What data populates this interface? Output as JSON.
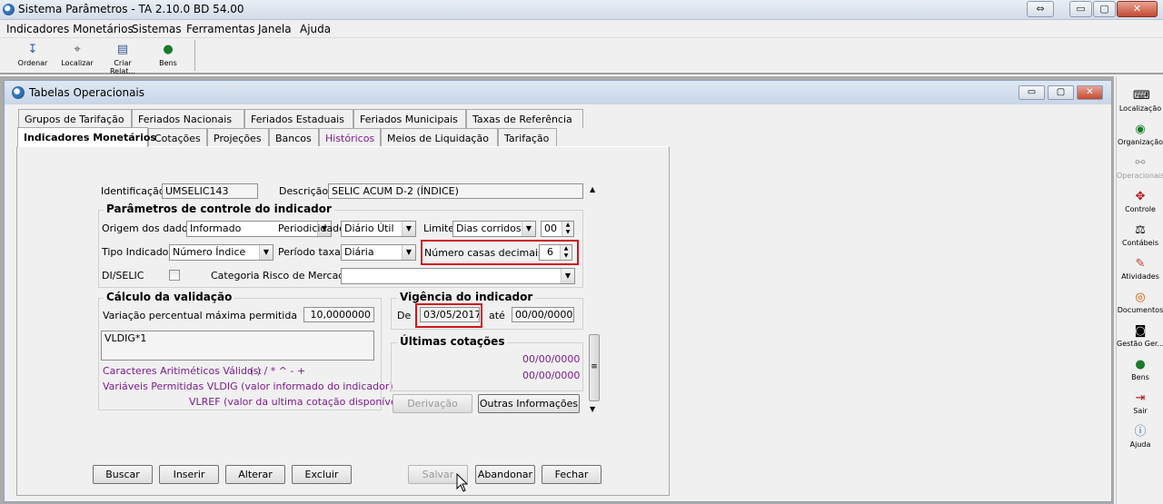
{
  "app": {
    "title": "Sistema Parâmetros -  TA 2.10.0 BD 54.00",
    "title_controls": [
      "⇔",
      "▭",
      "▢",
      "✕"
    ]
  },
  "menu": [
    "Indicadores Monetários",
    "Sistemas",
    "Ferramentas",
    "Janela",
    "Ajuda"
  ],
  "toolbar": [
    {
      "label": "Ordenar",
      "icon": "sort-icon"
    },
    {
      "label": "Localizar",
      "icon": "locate-icon"
    },
    {
      "label": "Criar Relat...",
      "icon": "printer-icon"
    },
    {
      "label": "Bens",
      "icon": "money-bag-icon"
    }
  ],
  "child": {
    "title": "Tabelas Operacionais"
  },
  "tabs_row1": [
    "Grupos de Tarifação",
    "Feriados Nacionais",
    "Feriados Estaduais",
    "Feriados Municipais",
    "Taxas de Referência"
  ],
  "tabs_row2": [
    "Indicadores Monetários",
    "Cotações",
    "Projeções",
    "Bancos",
    "Históricos",
    "Meios de Liquidação",
    "Tarifação"
  ],
  "form": {
    "identificacao_label": "Identificação",
    "identificacao_value": "UMSELIC143",
    "descricao_label": "Descrição",
    "descricao_value": "SELIC ACUM D-2 (ÍNDICE)",
    "params_title": "Parâmetros de controle do indicador",
    "origem_label": "Origem dos dados",
    "origem_value": "Informado",
    "periodicidade_label": "Periodicidade",
    "periodicidade_value": "Diário Útil",
    "limite_label": "Limite",
    "limite_value": "Dias corridos",
    "limite_num": "00",
    "tipo_label": "Tipo Indicador",
    "tipo_value": "Número Índice",
    "periodo_label": "Período taxa",
    "periodo_value": "Diária",
    "casas_label": "Número casas decimais",
    "casas_value": "6",
    "diselic_label": "DI/SELIC",
    "categoria_label": "Categoria Risco de Mercado",
    "categoria_value": ""
  },
  "calculo": {
    "title": "Cálculo da validação",
    "variacao_label": "Variação percentual máxima permitida",
    "variacao_value": "10,0000000",
    "formula": "VLDIG*1",
    "caracteres_label": "Caracteres Aritiméticos Válidos:",
    "caracteres_value": "( ) / * ^ - +",
    "variaveis_line1": "Variáveis Permitidas VLDIG  (valor informado do indicador)",
    "variaveis_line2": "VLREF  (valor da ultima cotação disponível)"
  },
  "vigencia": {
    "title": "Vigência do indicador",
    "de_label": "De",
    "de_value": "03/05/2017",
    "ate_label": "até",
    "ate_value": "00/00/0000"
  },
  "ultimas": {
    "title": "Últimas cotações",
    "values": [
      "00/00/0000",
      "00/00/0000"
    ]
  },
  "buttons": {
    "derivacao": "Derivação",
    "outras": "Outras Informações",
    "buscar": "Buscar",
    "inserir": "Inserir",
    "alterar": "Alterar",
    "excluir": "Excluir",
    "salvar": "Salvar",
    "abandonar": "Abandonar",
    "fechar": "Fechar"
  },
  "rightbar": [
    {
      "label": "Localização",
      "icon": "keyboard-icon"
    },
    {
      "label": "Organização",
      "icon": "globe-icon"
    },
    {
      "label": "Operacionais",
      "icon": "handshake-icon"
    },
    {
      "label": "Controle",
      "icon": "control-icon"
    },
    {
      "label": "Contábeis",
      "icon": "scales-icon"
    },
    {
      "label": "Atividades",
      "icon": "pen-icon"
    },
    {
      "label": "Documentos",
      "icon": "target-icon"
    },
    {
      "label": "Gestão Ger...",
      "icon": "camera-icon"
    },
    {
      "label": "Bens",
      "icon": "money-bag-icon"
    },
    {
      "label": "Sair",
      "icon": "exit-icon"
    },
    {
      "label": "Ajuda",
      "icon": "help-icon"
    }
  ],
  "colors": {
    "purple": "#7a1e8a",
    "highlight": "#d0141c"
  }
}
